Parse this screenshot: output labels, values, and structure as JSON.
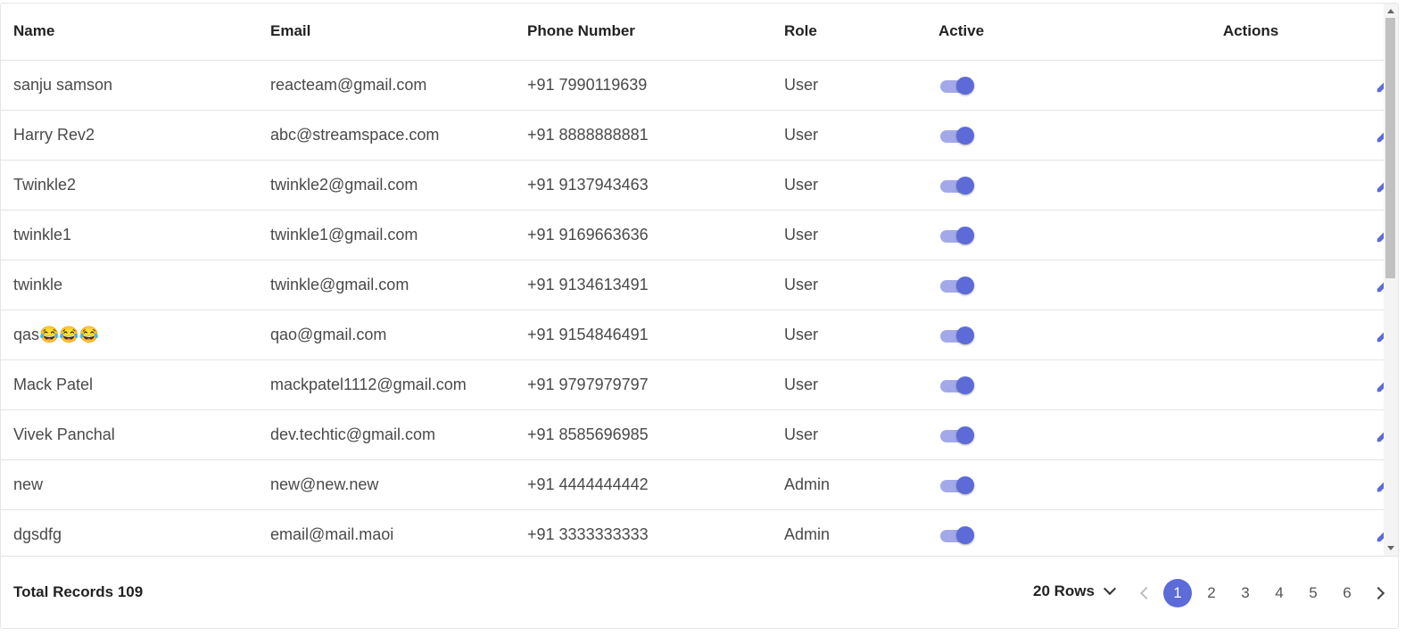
{
  "table": {
    "columns": [
      "Name",
      "Email",
      "Phone Number",
      "Role",
      "Active",
      "Actions"
    ],
    "rows": [
      {
        "name": "sanju samson",
        "email": "reacteam@gmail.com",
        "phone": "+91 7990119639",
        "role": "User",
        "active": true
      },
      {
        "name": "Harry Rev2",
        "email": "abc@streamspace.com",
        "phone": "+91 8888888881",
        "role": "User",
        "active": true
      },
      {
        "name": "Twinkle2",
        "email": "twinkle2@gmail.com",
        "phone": "+91 9137943463",
        "role": "User",
        "active": true
      },
      {
        "name": "twinkle1",
        "email": "twinkle1@gmail.com",
        "phone": "+91 9169663636",
        "role": "User",
        "active": true
      },
      {
        "name": "twinkle",
        "email": "twinkle@gmail.com",
        "phone": "+91 9134613491",
        "role": "User",
        "active": true
      },
      {
        "name": "qas😂😂😂",
        "email": "qao@gmail.com",
        "phone": "+91 9154846491",
        "role": "User",
        "active": true
      },
      {
        "name": "Mack Patel",
        "email": "mackpatel1112@gmail.com",
        "phone": "+91 9797979797",
        "role": "User",
        "active": true
      },
      {
        "name": "Vivek Panchal",
        "email": "dev.techtic@gmail.com",
        "phone": "+91 8585696985",
        "role": "User",
        "active": true
      },
      {
        "name": "new",
        "email": "new@new.new",
        "phone": "+91 4444444442",
        "role": "Admin",
        "active": true
      },
      {
        "name": "dgsdfg",
        "email": "email@mail.maoi",
        "phone": "+91 3333333333",
        "role": "Admin",
        "active": true
      }
    ],
    "action_icons": [
      "pencil-icon",
      "trash-icon",
      "info-icon"
    ]
  },
  "footer": {
    "total_records": "Total Records 109",
    "rows_per_page": "20 Rows",
    "pages": [
      "1",
      "2",
      "3",
      "4",
      "5",
      "6"
    ],
    "current_page": "1"
  },
  "colors": {
    "accent": "#5c6bd7",
    "toggle_track": "#a3a9e8",
    "delete": "#f44336",
    "border": "#e4e4e4"
  }
}
